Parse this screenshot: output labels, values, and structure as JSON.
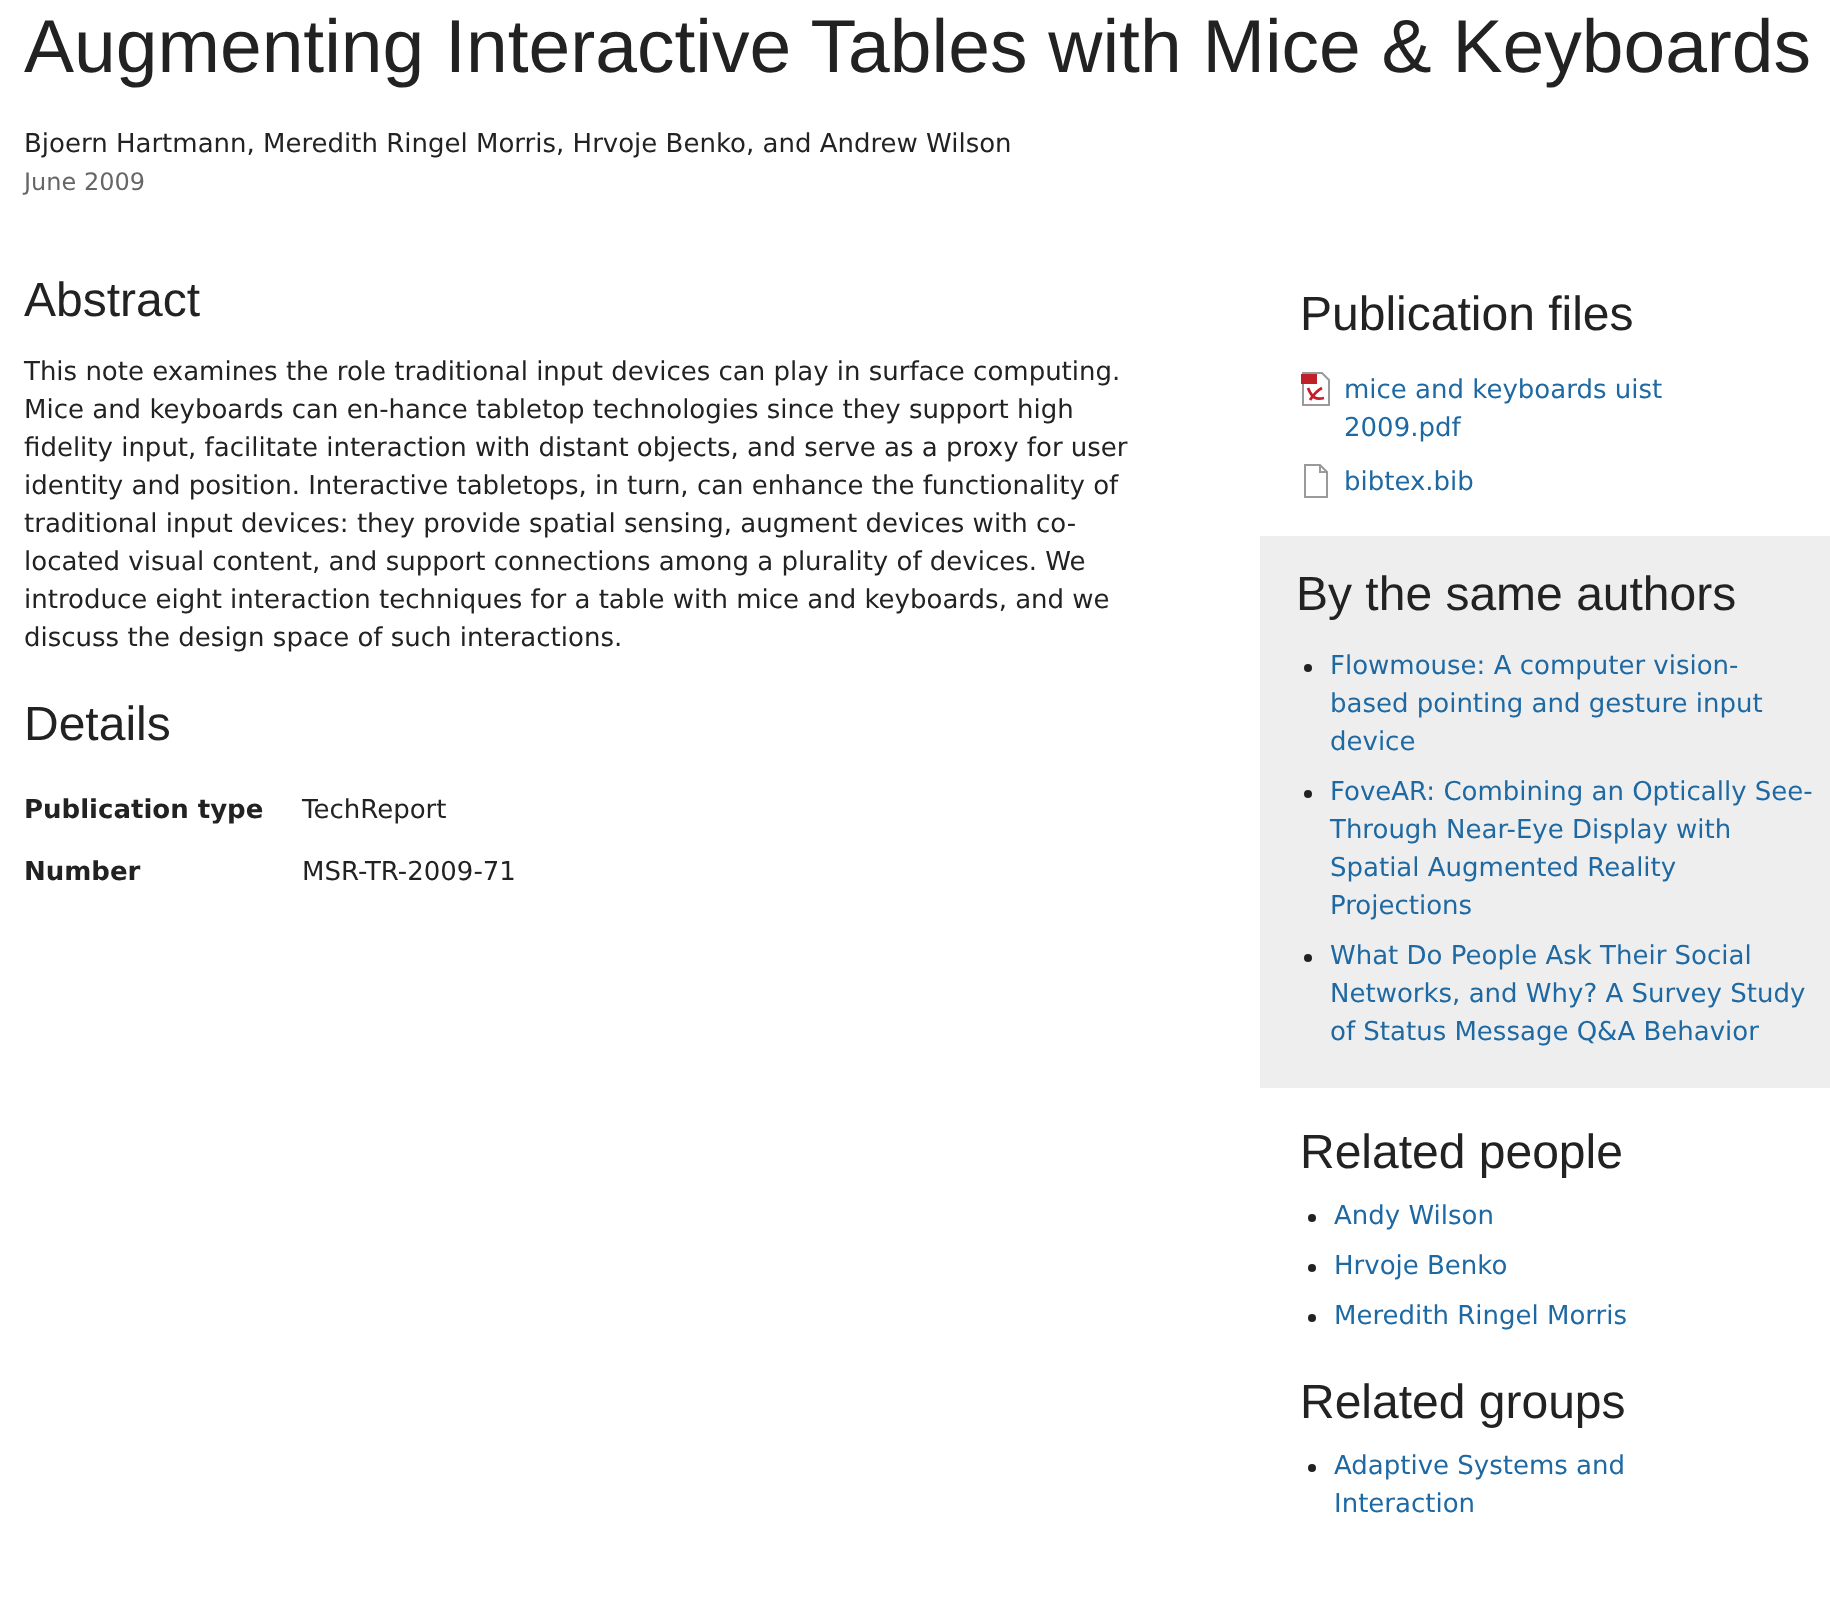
{
  "title": "Augmenting Interactive Tables with Mice & Keyboards",
  "authors": "Bjoern Hartmann, Meredith Ringel Morris, Hrvoje Benko, and Andrew Wilson",
  "date": "June 2009",
  "abstract": {
    "heading": "Abstract",
    "text": "This note examines the role traditional input devices can play in surface computing. Mice and keyboards can en-hance tabletop technologies since they support high fidelity input, facilitate interaction with distant objects, and serve as a proxy for user identity and position. Interactive tabletops, in turn, can enhance the functionality of traditional input devices: they provide spatial sensing, augment devices with co-located visual content, and support connections among a plurality of devices. We introduce eight interaction techniques for a table with mice and keyboards, and we discuss the design space of such interactions."
  },
  "details": {
    "heading": "Details",
    "rows": [
      {
        "label": "Publication type",
        "value": "TechReport"
      },
      {
        "label": "Number",
        "value": "MSR-TR-2009-71"
      }
    ]
  },
  "publication_files": {
    "heading": "Publication files",
    "files": [
      {
        "kind": "pdf",
        "name": "mice and keyboards uist 2009.pdf"
      },
      {
        "kind": "document",
        "name": "bibtex.bib"
      }
    ]
  },
  "same_authors": {
    "heading": "By the same authors",
    "items": [
      "Flowmouse: A computer vision-based pointing and gesture input device",
      "FoveAR: Combining an Optically See-Through Near-Eye Display with Spatial Augmented Reality Projections",
      "What Do People Ask Their Social Networks, and Why? A Survey Study of Status Message Q&A Behavior"
    ]
  },
  "related_people": {
    "heading": "Related people",
    "items": [
      "Andy Wilson",
      "Hrvoje Benko",
      "Meredith Ringel Morris"
    ]
  },
  "related_groups": {
    "heading": "Related groups",
    "items": [
      "Adaptive Systems and Interaction"
    ]
  }
}
